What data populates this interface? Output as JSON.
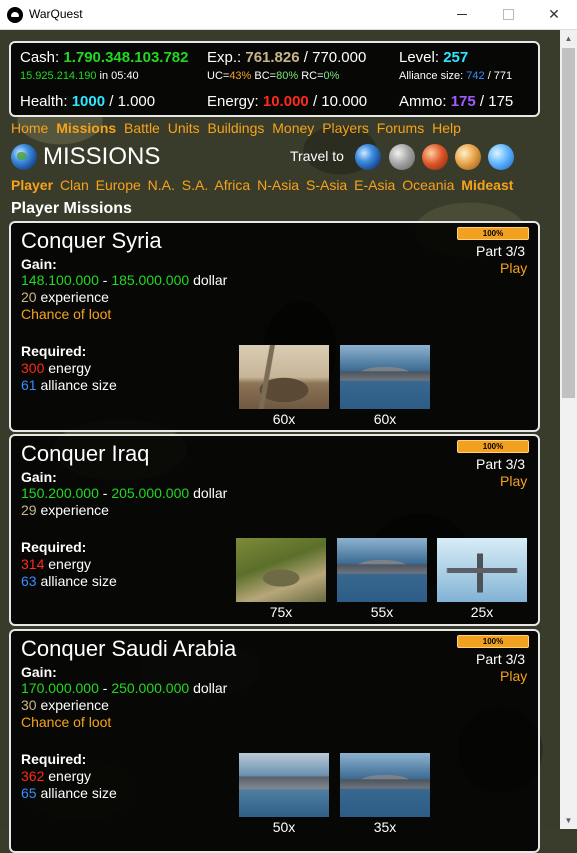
{
  "window": {
    "title": "WarQuest"
  },
  "stats": {
    "cash_label": "Cash:",
    "cash_value": "1.790.348.103.782",
    "cash_income": "15.925.214.190",
    "cash_income_suffix": "in 05:40",
    "exp_label": "Exp.:",
    "exp_value": "761.826",
    "exp_max": "/ 770.000",
    "level_label": "Level:",
    "level_value": "257",
    "uc_label": "UC=",
    "uc_value": "43%",
    "bc_label": "BC=",
    "bc_value": "80%",
    "rc_label": "RC=",
    "rc_value": "0%",
    "alliance_label": "Alliance size:",
    "alliance_value": "742",
    "alliance_max": "/ 771",
    "health_label": "Health:",
    "health_value": "1000",
    "health_max": "/ 1.000",
    "energy_label": "Energy:",
    "energy_value": "10.000",
    "energy_max": "/ 10.000",
    "ammo_label": "Ammo:",
    "ammo_value": "175",
    "ammo_max": "/ 175"
  },
  "menu": {
    "items": [
      "Home",
      "Missions",
      "Battle",
      "Units",
      "Buildings",
      "Money",
      "Players",
      "Forums",
      "Help"
    ],
    "active": "Missions"
  },
  "page": {
    "title": "MISSIONS",
    "travel_label": "Travel to"
  },
  "regions": {
    "items": [
      "Player",
      "Clan",
      "Europe",
      "N.A.",
      "S.A.",
      "Africa",
      "N-Asia",
      "S-Asia",
      "E-Asia",
      "Oceania",
      "Mideast"
    ],
    "active": [
      "Player",
      "Mideast"
    ]
  },
  "section": {
    "title": "Player Missions"
  },
  "labels": {
    "gain": "Gain:",
    "required": "Required:",
    "dollar": "dollar",
    "experience": "experience",
    "energy": "energy",
    "alliance_size": "alliance size",
    "dash": "-",
    "loot": "Chance of loot",
    "part": "Part 3/3",
    "play": "Play",
    "progress": "100%"
  },
  "missions": [
    {
      "name": "Conquer Syria",
      "gain_min": "148.100.000",
      "gain_max": "185.000.000",
      "experience": "20",
      "loot": true,
      "energy": "300",
      "alliance": "61",
      "units": [
        {
          "icon": "artillery-image",
          "count": "60x"
        },
        {
          "icon": "ship-image",
          "count": "60x"
        }
      ]
    },
    {
      "name": "Conquer Iraq",
      "gain_min": "150.200.000",
      "gain_max": "205.000.000",
      "experience": "29",
      "loot": false,
      "energy": "314",
      "alliance": "63",
      "units": [
        {
          "icon": "howitzer-image",
          "count": "75x"
        },
        {
          "icon": "ship-image",
          "count": "55x"
        },
        {
          "icon": "bomber-image",
          "count": "25x"
        }
      ]
    },
    {
      "name": "Conquer Saudi Arabia",
      "gain_min": "170.000.000",
      "gain_max": "250.000.000",
      "experience": "30",
      "loot": true,
      "energy": "362",
      "alliance": "65",
      "units": [
        {
          "icon": "carrier-image",
          "count": "50x"
        },
        {
          "icon": "ship-image",
          "count": "35x"
        }
      ]
    }
  ]
}
